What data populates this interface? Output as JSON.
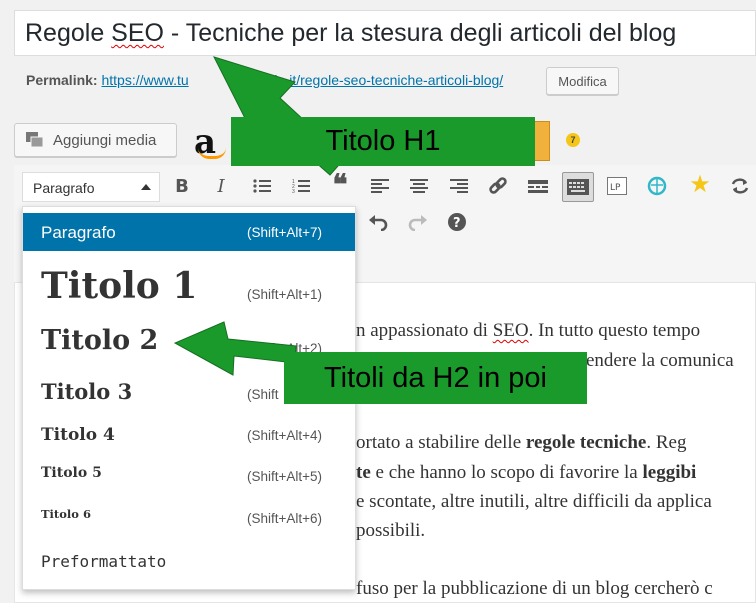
{
  "title": {
    "before": "Regole ",
    "squiggle": "SEO",
    "after": " - Tecniche per la stesura degli articoli del blog"
  },
  "permalink": {
    "label": "Permalink:",
    "url": "https://www.tu",
    "url_rest": "ale.it/regole-seo-tecniche-articoli-blog/",
    "edit_label": "Modifica"
  },
  "media": {
    "button_label": "Aggiungi media"
  },
  "toolbar": {
    "format_value": "Paragrafo"
  },
  "format_menu": {
    "items": [
      {
        "label": "Paragrafo",
        "shortcut": "(Shift+Alt+7)"
      },
      {
        "label": "Titolo 1",
        "shortcut": "(Shift+Alt+1)"
      },
      {
        "label": "Titolo 2",
        "shortcut": "(Shift+Alt+2)"
      },
      {
        "label": "Titolo 3",
        "shortcut": "(Shift"
      },
      {
        "label": "Titolo 4",
        "shortcut": "(Shift+Alt+4)"
      },
      {
        "label": "Titolo 5",
        "shortcut": "(Shift+Alt+5)"
      },
      {
        "label": "Titolo 6",
        "shortcut": "(Shift+Alt+6)"
      },
      {
        "label": "Preformattato",
        "shortcut": ""
      }
    ]
  },
  "content": {
    "line1_pre": "n appassionato di ",
    "line1_seo": "SEO",
    "line1_post": ". In tutto questo tempo",
    "line2": "endere la comunica",
    "line3_pre": "ortato a stabilire delle ",
    "line3_bold": "regole tecniche",
    "line3_post": ". Reg",
    "line4_bold1": "te",
    "line4_mid": " e che hanno lo scopo di favorire la ",
    "line4_bold2": "leggibi",
    "line5": "e scontate, altre inutili, altre difficili da applica",
    "line6": "possibili.",
    "line7": "fuso per la pubblicazione di un blog cercherò c"
  },
  "annotations": {
    "h1_label": "Titolo H1",
    "h2_label": "Titoli da H2 in poi",
    "color": "#1b9a2c"
  }
}
